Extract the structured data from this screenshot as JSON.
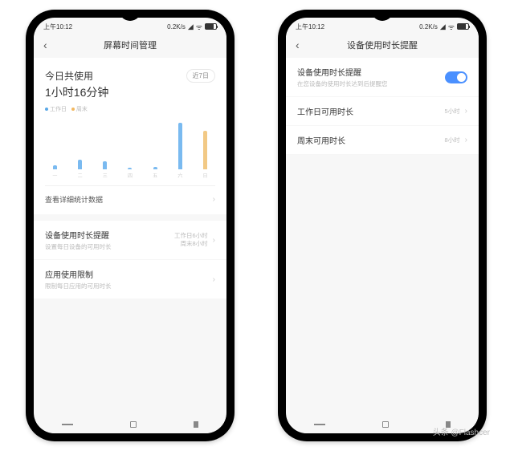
{
  "status": {
    "time": "上午10:12",
    "speed": "0.2K/s"
  },
  "left": {
    "title": "屏幕时间管理",
    "today_label": "今日共使用",
    "today_time": "1小时16分钟",
    "period": "近7日",
    "legend_workday": "工作日",
    "legend_weekend": "周末",
    "detail_link": "查看详细统计数据",
    "reminder": {
      "title": "设备使用时长提醒",
      "sub": "设置每日设备的可用时长",
      "meta1": "工作日6小时",
      "meta2": "周末8小时"
    },
    "app_limit": {
      "title": "应用使用限制",
      "sub": "限制每日应用的可用时长"
    }
  },
  "right": {
    "title": "设备使用时长提醒",
    "main": {
      "title": "设备使用时长提醒",
      "sub": "在您设备的使用时长达到后提醒您"
    },
    "workday": {
      "label": "工作日可用时长",
      "value": "5小时"
    },
    "weekend": {
      "label": "周末可用时长",
      "value": "8小时"
    }
  },
  "chart_data": {
    "type": "bar",
    "title": "今日共使用 1小时16分钟",
    "categories": [
      "一",
      "二",
      "三",
      "四",
      "五",
      "六",
      "日"
    ],
    "series": [
      {
        "name": "工作日",
        "values": [
          5,
          12,
          10,
          2,
          3,
          58,
          0
        ]
      },
      {
        "name": "周末",
        "values": [
          0,
          0,
          0,
          0,
          0,
          0,
          48
        ]
      }
    ],
    "ylim": [
      0,
      60
    ],
    "ylabel": "",
    "xlabel": ""
  },
  "watermark": "头条 @Flashcer"
}
